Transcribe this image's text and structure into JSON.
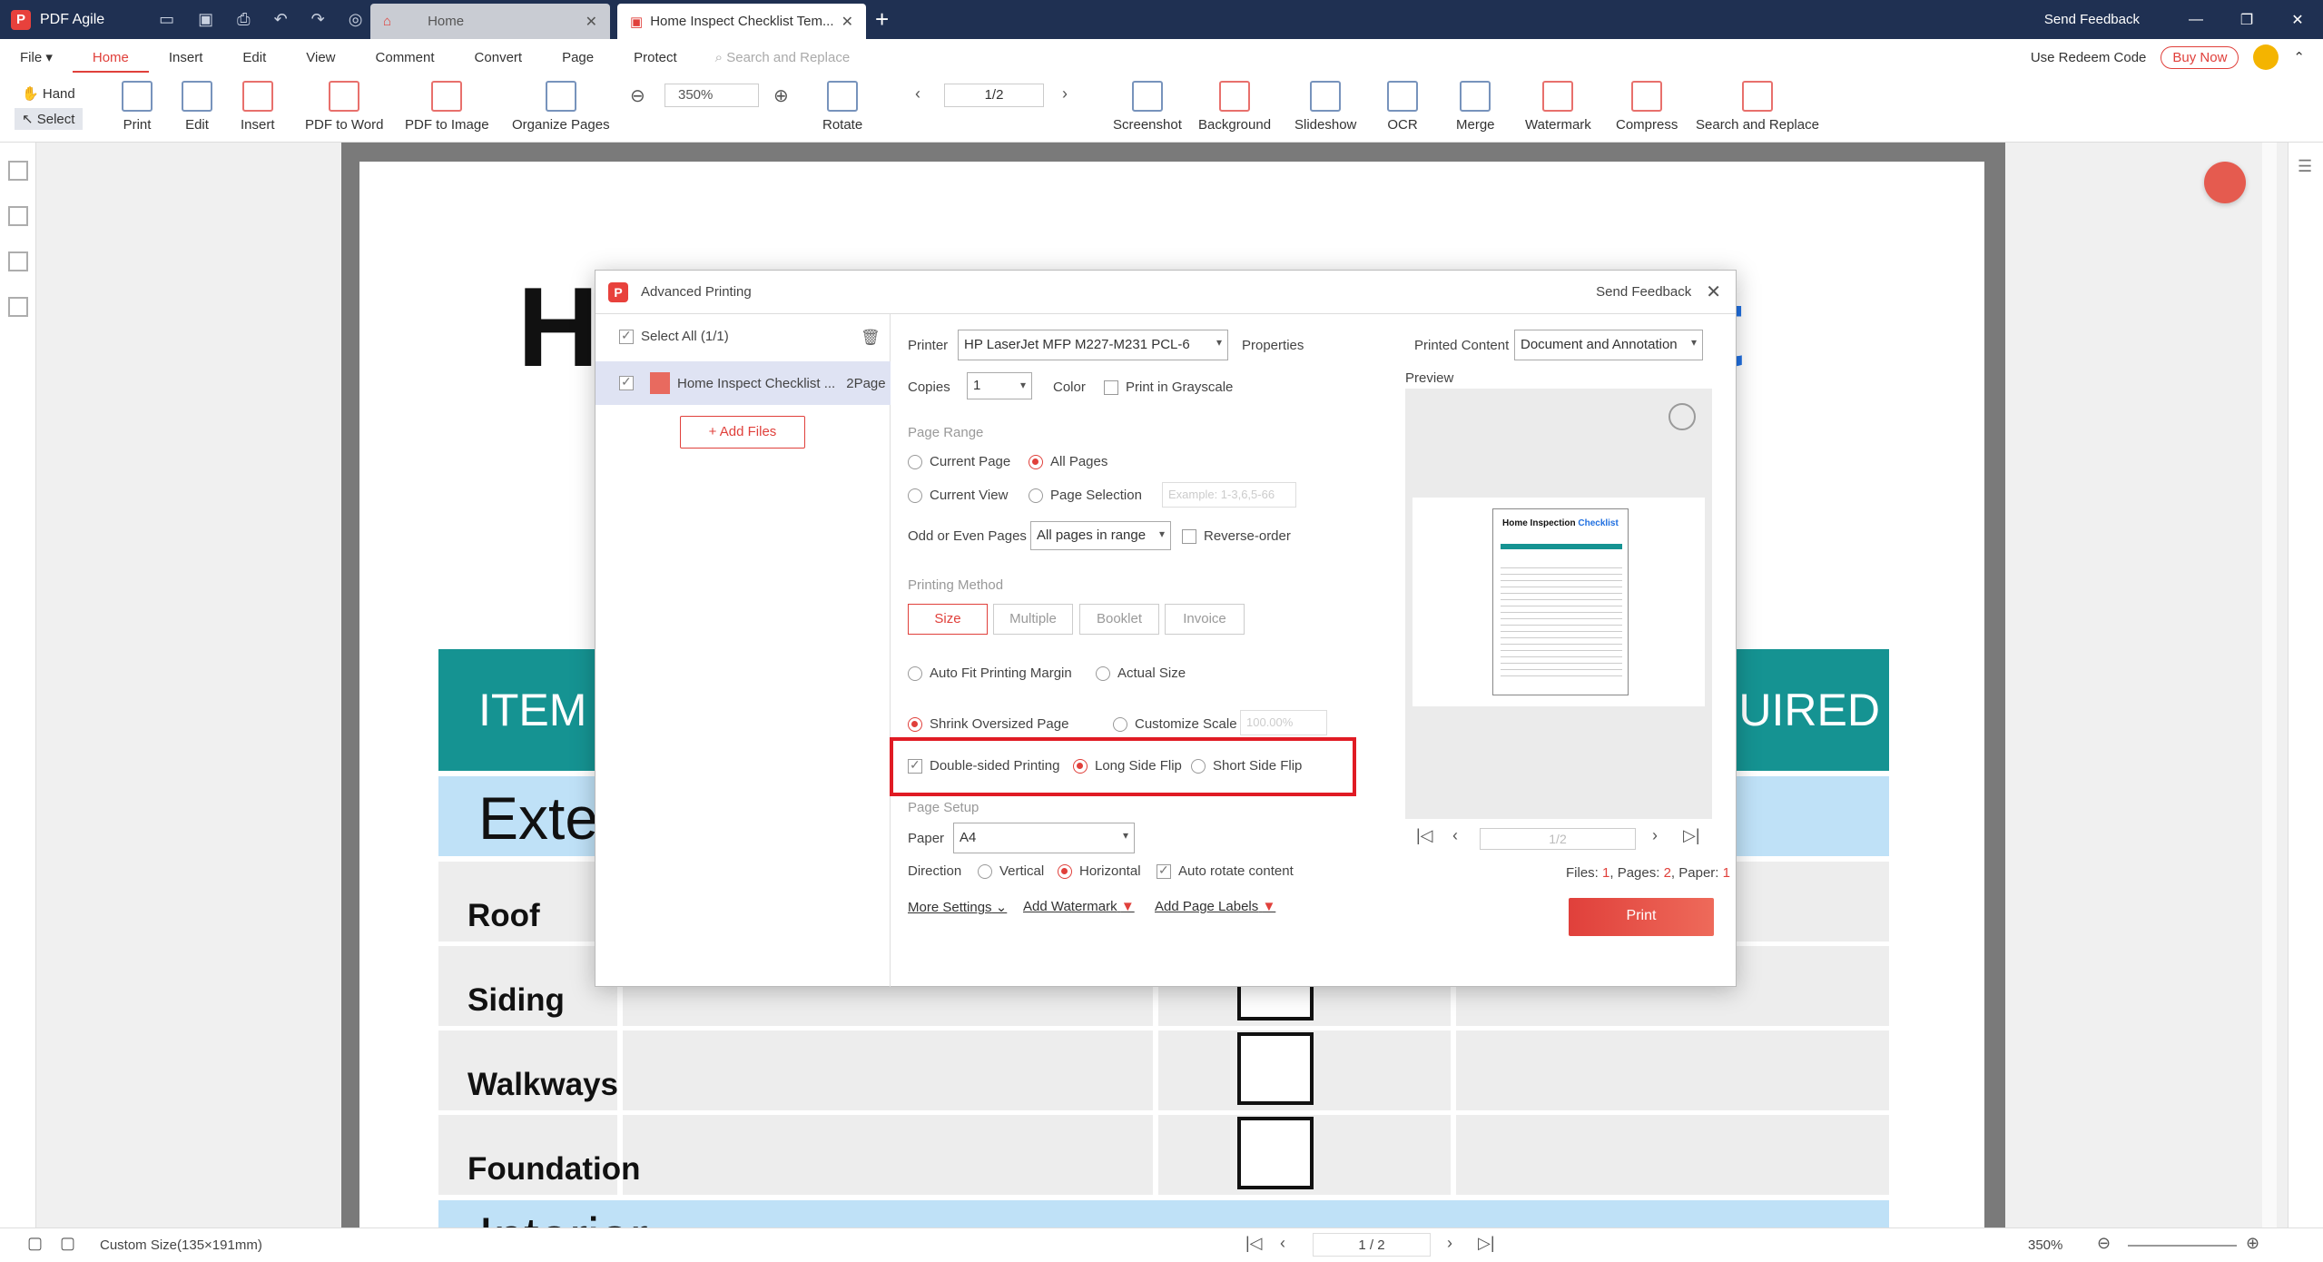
{
  "titlebar": {
    "app_name": "PDF Agile",
    "tab_home": "Home",
    "tab_doc": "Home Inspect Checklist Tem...",
    "send_feedback": "Send Feedback"
  },
  "menu": {
    "file": "File",
    "items": [
      "Home",
      "Insert",
      "Edit",
      "View",
      "Comment",
      "Convert",
      "Page",
      "Protect"
    ],
    "search": "Search and Replace",
    "redeem": "Use Redeem Code",
    "buy": "Buy Now"
  },
  "toolbar": {
    "hand": "Hand",
    "select": "Select",
    "print": "Print",
    "edit": "Edit",
    "insert": "Insert",
    "pdf_to_word": "PDF to Word",
    "pdf_to_image": "PDF to Image",
    "organize": "Organize Pages",
    "zoom": "350%",
    "rotate": "Rotate",
    "page": "1/2",
    "screenshot": "Screenshot",
    "background": "Background",
    "slideshow": "Slideshow",
    "ocr": "OCR",
    "merge": "Merge",
    "watermark": "Watermark",
    "compress": "Compress",
    "search_replace": "Search and Replace"
  },
  "document": {
    "title_left": "H",
    "title_right": "st",
    "head_item": "ITEM",
    "head_req": "UIRED",
    "section_ext": "Exte",
    "rows": [
      "Roof",
      "Siding",
      "Walkways",
      "Foundation"
    ],
    "section_int": "Interior"
  },
  "dialog": {
    "title": "Advanced Printing",
    "send_feedback": "Send Feedback",
    "select_all": "Select All (1/1)",
    "file_name": "Home Inspect Checklist ...",
    "file_pages": "2Page",
    "add_files": "+ Add Files",
    "printer_label": "Printer",
    "printer": "HP LaserJet MFP M227-M231 PCL-6",
    "properties": "Properties",
    "printed_content_label": "Printed Content",
    "printed_content": "Document and Annotation",
    "copies_label": "Copies",
    "copies": "1",
    "color_label": "Color",
    "grayscale": "Print in Grayscale",
    "page_range": "Page Range",
    "current_page": "Current Page",
    "all_pages": "All Pages",
    "current_view": "Current View",
    "page_selection": "Page Selection",
    "page_sel_placeholder": "Example: 1-3,6,5-66",
    "odd_even_label": "Odd or Even Pages",
    "odd_even": "All pages in range",
    "reverse": "Reverse-order",
    "printing_method": "Printing Method",
    "methods": [
      "Size",
      "Multiple",
      "Booklet",
      "Invoice"
    ],
    "auto_fit": "Auto Fit Printing Margin",
    "actual_size": "Actual Size",
    "shrink": "Shrink Oversized Page",
    "customize_scale": "Customize Scale",
    "scale_value": "100.00%",
    "double_sided": "Double-sided Printing",
    "long_flip": "Long Side Flip",
    "short_flip": "Short Side Flip",
    "page_setup": "Page Setup",
    "paper_label": "Paper",
    "paper": "A4",
    "direction_label": "Direction",
    "vertical": "Vertical",
    "horizontal": "Horizontal",
    "auto_rotate": "Auto rotate content",
    "more_settings": "More Settings",
    "add_watermark": "Add Watermark",
    "add_page_labels": "Add Page Labels",
    "preview_label": "Preview",
    "preview_title": "Home Inspection",
    "preview_title_blue": "Checklist",
    "preview_page": "1/2",
    "stats_files_label": "Files:",
    "stats_files": "1",
    "stats_pages_label": "Pages:",
    "stats_pages": "2",
    "stats_paper_label": "Paper:",
    "stats_paper": "1",
    "print": "Print"
  },
  "status": {
    "size": "Custom Size(135×191mm)",
    "page": "1 / 2",
    "zoom": "350%"
  },
  "colors": {
    "accent": "#e0403b",
    "titlebar": "#1f3052",
    "teal": "#159392",
    "light_blue": "#bfe1f7",
    "highlight": "#e01b24"
  }
}
